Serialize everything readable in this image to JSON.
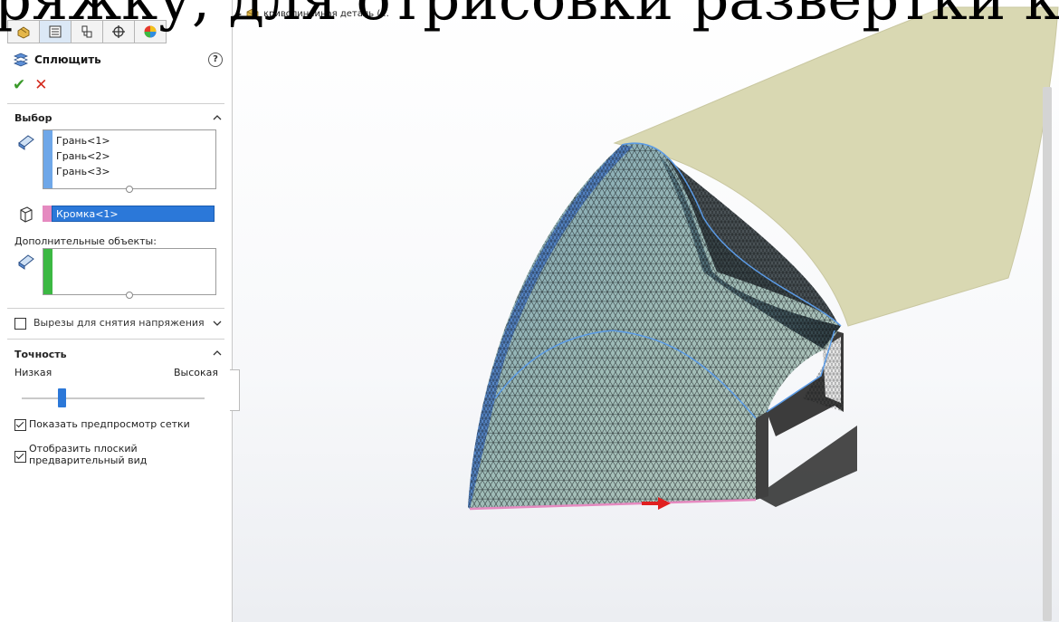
{
  "overlay_text": "ряжку, для отрисовки развёртки которой при",
  "toolbar": {
    "tabs": [
      {
        "icon": "feature-manager-icon"
      },
      {
        "icon": "property-manager-icon"
      },
      {
        "icon": "configuration-manager-icon"
      },
      {
        "icon": "dimxpert-icon"
      },
      {
        "icon": "display-manager-icon"
      }
    ]
  },
  "feature": {
    "title": "Сплющить",
    "help": "?",
    "ok": "✔",
    "cancel": "✕"
  },
  "selection": {
    "title": "Выбор",
    "faces": [
      "Грань<1>",
      "Грань<2>",
      "Грань<3>"
    ],
    "edge": "Кромка<1>",
    "faces_color": "#6fa7e8",
    "edge_color": "#e58ac0"
  },
  "additional": {
    "label": "Дополнительные объекты:",
    "color": "#3cb843"
  },
  "relief": {
    "label": "Вырезы для снятия напряжения"
  },
  "accuracy": {
    "title": "Точность",
    "low": "Низкая",
    "high": "Высокая",
    "level": 0.22
  },
  "options": {
    "show_mesh": "Показать предпросмотр сетки",
    "show_flat": "Отобразить плоский предварительный вид"
  },
  "tree": {
    "part_name": "криволинеиная деталь (..."
  }
}
